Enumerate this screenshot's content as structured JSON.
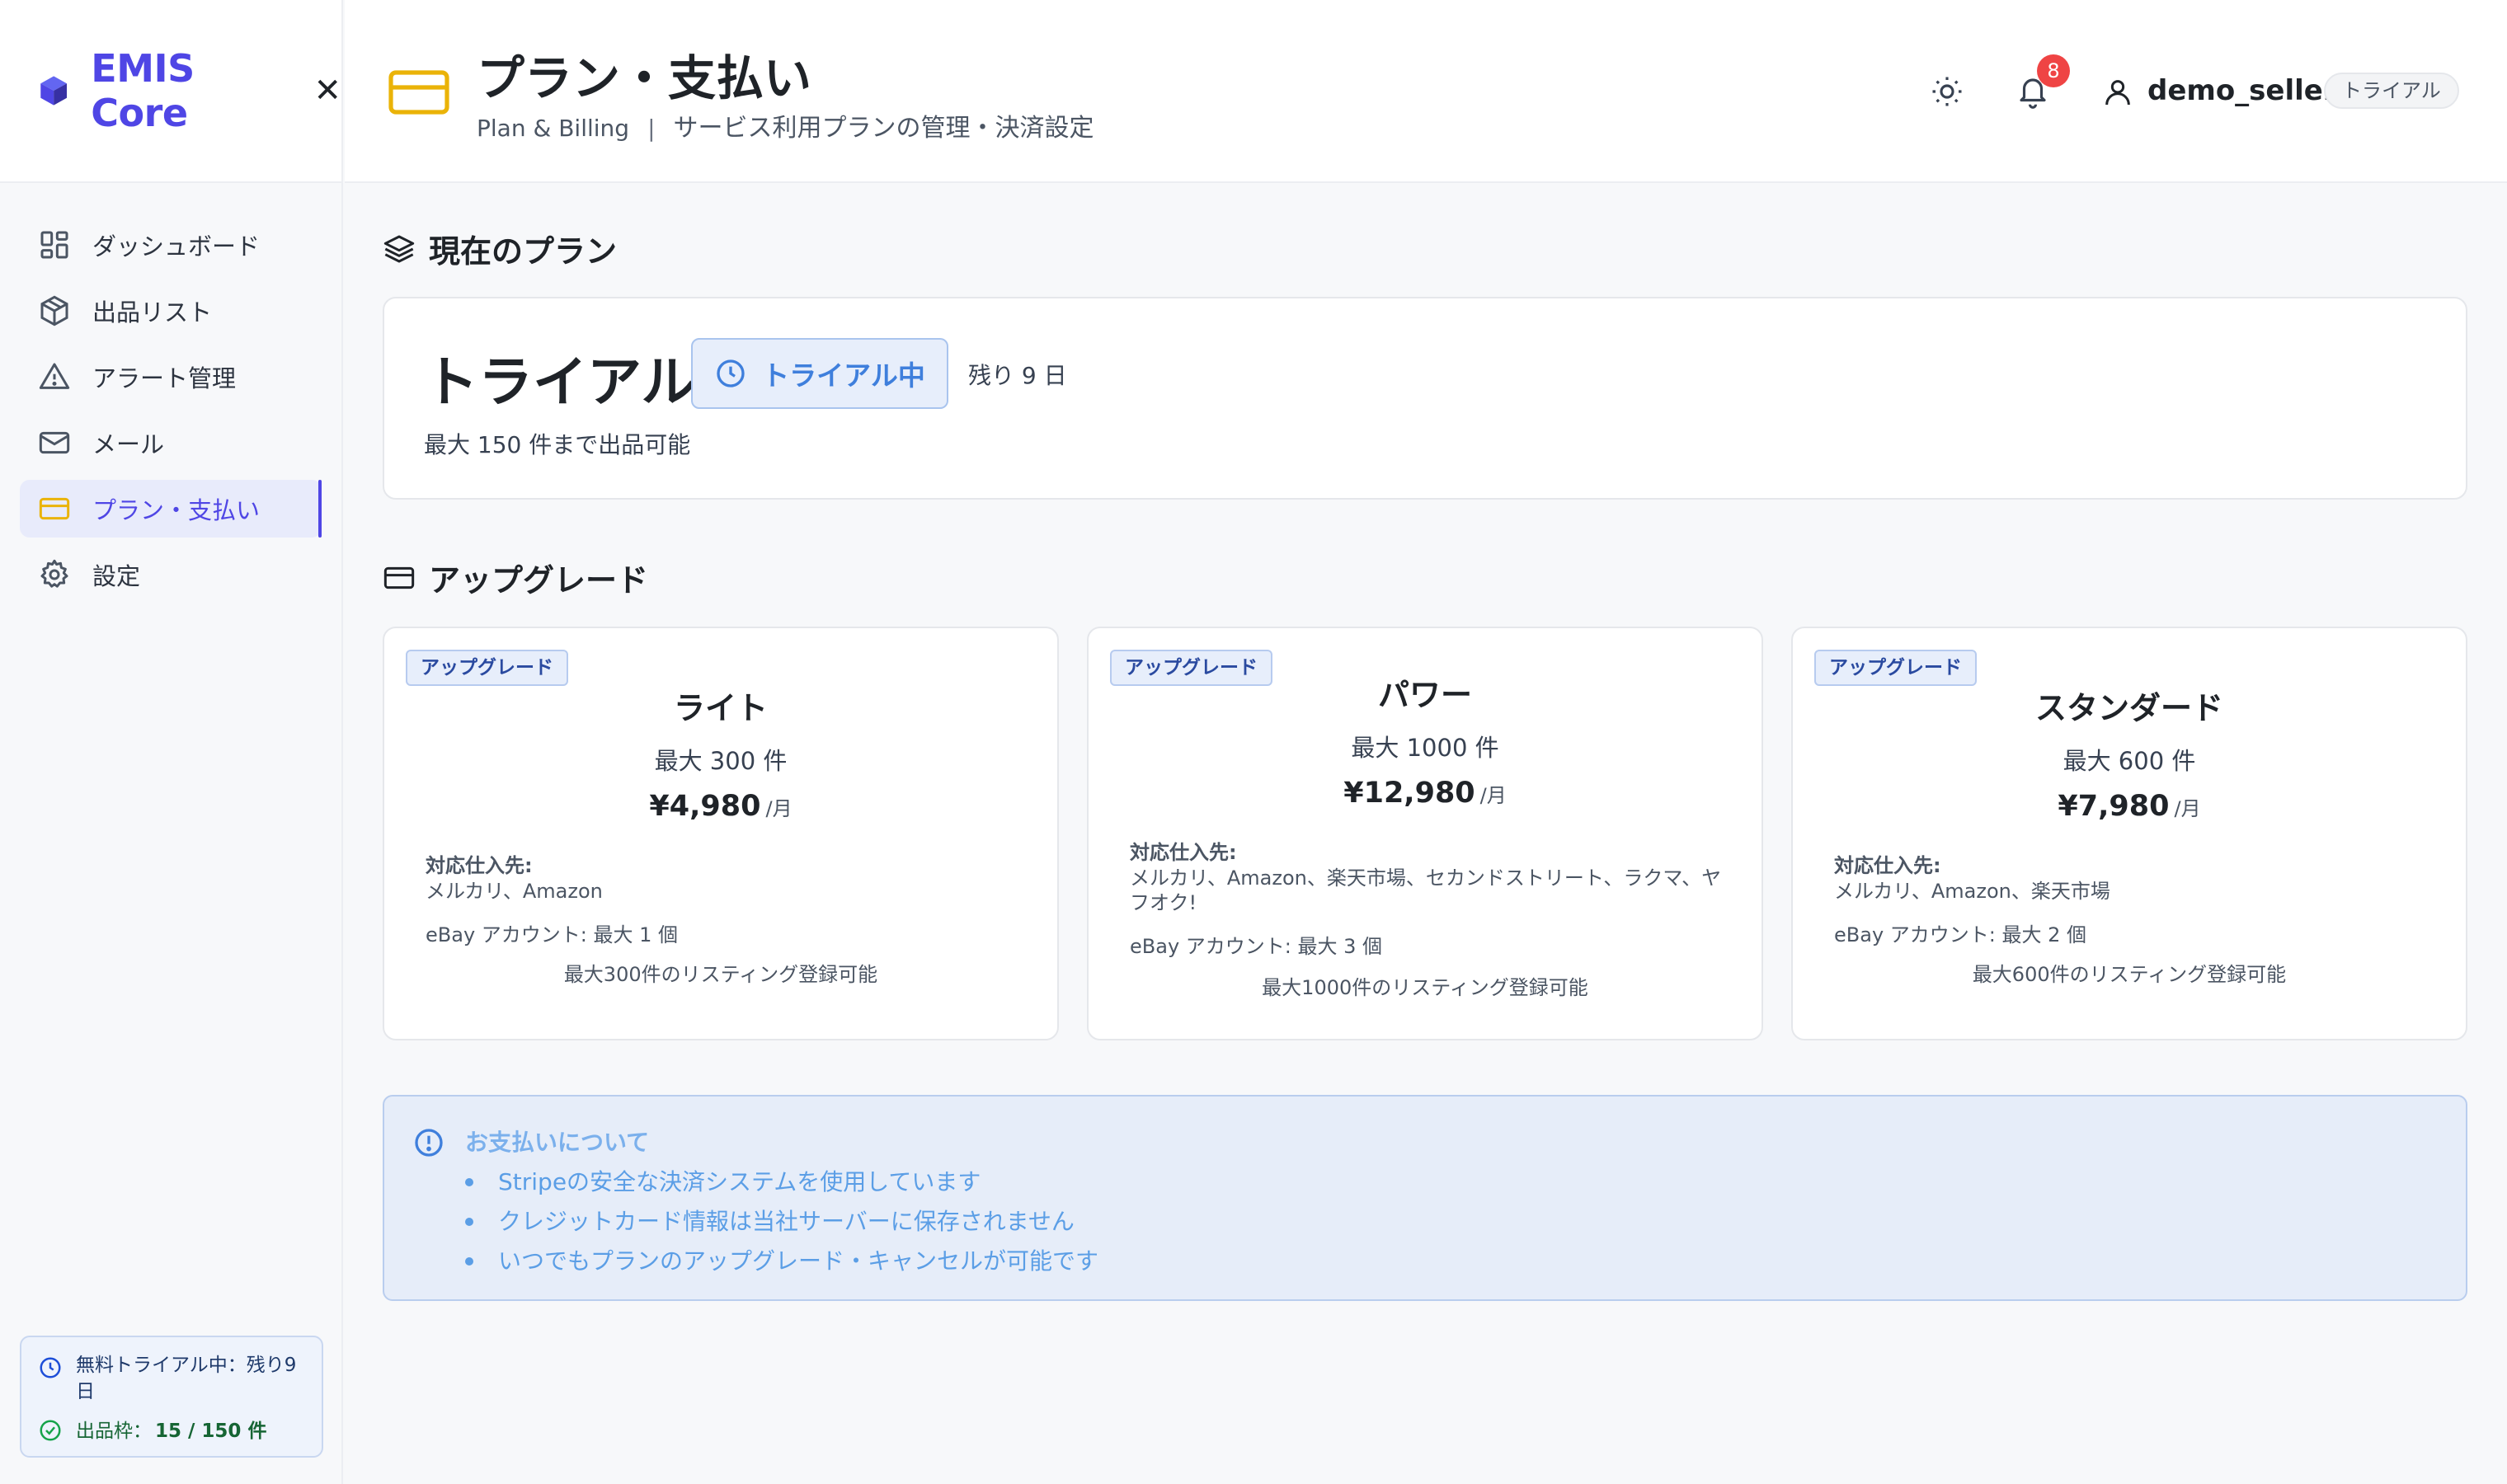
{
  "sidebar": {
    "brand": "EMIS Core",
    "items": [
      {
        "label": "ダッシュボード",
        "icon": "grid-icon"
      },
      {
        "label": "出品リスト",
        "icon": "box-icon"
      },
      {
        "label": "アラート管理",
        "icon": "warning-icon"
      },
      {
        "label": "メール",
        "icon": "mail-icon"
      },
      {
        "label": "プラン・支払い",
        "icon": "card-icon",
        "active": true
      },
      {
        "label": "設定",
        "icon": "gear-icon"
      }
    ],
    "trial_status": "無料トライアル中：残り9日",
    "quota_label": "出品枠：",
    "quota_value": "15 / 150 件"
  },
  "header": {
    "title": "プラン・支払い",
    "subtitle_en": "Plan & Billing",
    "subtitle_sep": "|",
    "subtitle_ja": "サービス利用プランの管理・決済設定",
    "notification_count": "8",
    "username": "demo_seller",
    "user_tag": "トライアル"
  },
  "current_plan": {
    "section_title": "現在のプラン",
    "name": "トライアル",
    "status": "トライアル中",
    "remaining": "残り 9 日",
    "limit": "最大 150 件まで出品可能"
  },
  "upgrade": {
    "section_title": "アップグレード",
    "badge": "アップグレード",
    "sources_label": "対応仕入先:",
    "per_month": "/月",
    "plans": [
      {
        "name": "ライト",
        "max": "最大 300 件",
        "price": "¥4,980",
        "sources": "メルカリ、Amazon",
        "ebay": "eBay アカウント: 最大 1 個",
        "registration": "最大300件のリスティング登録可能"
      },
      {
        "name": "パワー",
        "max": "最大 1000 件",
        "price": "¥12,980",
        "sources": "メルカリ、Amazon、楽天市場、セカンドストリート、ラクマ、ヤフオク!",
        "ebay": "eBay アカウント: 最大 3 個",
        "registration": "最大1000件のリスティング登録可能"
      },
      {
        "name": "スタンダード",
        "max": "最大 600 件",
        "price": "¥7,980",
        "sources": "メルカリ、Amazon、楽天市場",
        "ebay": "eBay アカウント: 最大 2 個",
        "registration": "最大600件のリスティング登録可能"
      }
    ]
  },
  "payment_info": {
    "title": "お支払いについて",
    "items": [
      "Stripeの安全な決済システムを使用しています",
      "クレジットカード情報は当社サーバーに保存されません",
      "いつでもプランのアップグレード・キャンセルが可能です"
    ]
  },
  "colors": {
    "brand": "#4f46e5",
    "card_icon": "#eab308",
    "info_blue": "#5b9ee6",
    "badge_red": "#ef4444"
  }
}
